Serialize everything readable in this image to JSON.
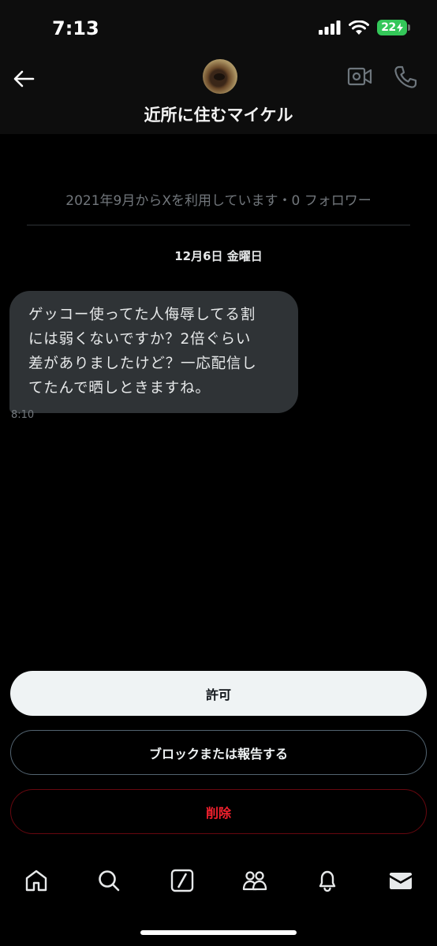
{
  "status_bar": {
    "time": "7:13",
    "battery": "22",
    "icons": [
      "cellular-signal-icon",
      "wifi-icon",
      "battery-charging-icon"
    ]
  },
  "header": {
    "title": "近所に住むマイケル",
    "icons": [
      "back-arrow-icon",
      "avatar",
      "video-camera-icon",
      "phone-icon"
    ]
  },
  "conversation": {
    "join_info": "2021年9月からXを利用しています・0 フォロワー",
    "date_label": "12月6日 金曜日",
    "messages": [
      {
        "lines": [
          "ゲッコー使ってた人侮辱してる割",
          "には弱くないですか？2倍ぐらい",
          "差がありましたけど？一応配信し",
          "てたんで晒しときますね。"
        ],
        "time": "8:10"
      }
    ]
  },
  "actions": {
    "allow": "許可",
    "block_report": "ブロックまたは報告する",
    "delete": "削除"
  },
  "bottom_nav": {
    "items": [
      "home-icon",
      "search-icon",
      "grok-icon",
      "communities-icon",
      "notifications-icon",
      "messages-icon"
    ]
  },
  "colors": {
    "background": "#000000",
    "bubble": "#2f3336",
    "delete_red": "#f4212e",
    "battery_green": "#34c759"
  }
}
